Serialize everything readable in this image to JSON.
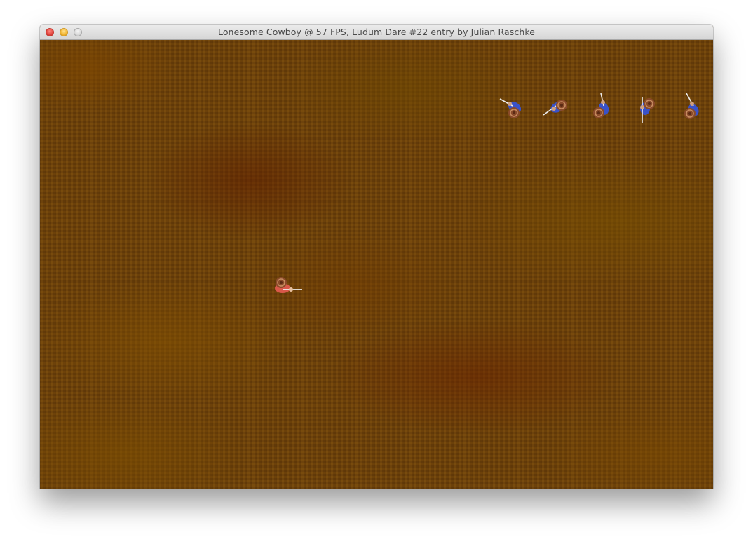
{
  "window": {
    "title": "Lonesome Cowboy @ 57 FPS, Ludum Dare #22 entry by Julian Raschke"
  },
  "sprites": {
    "player": {
      "role": "cowboy",
      "shirt_color": "#d9584a"
    },
    "enemy_color": "#3a52c8",
    "enemy_count": 5
  },
  "colors": {
    "ground": "#6b3f09",
    "ground_light": "#8a6300",
    "titlebar": "#e2e2e2"
  }
}
